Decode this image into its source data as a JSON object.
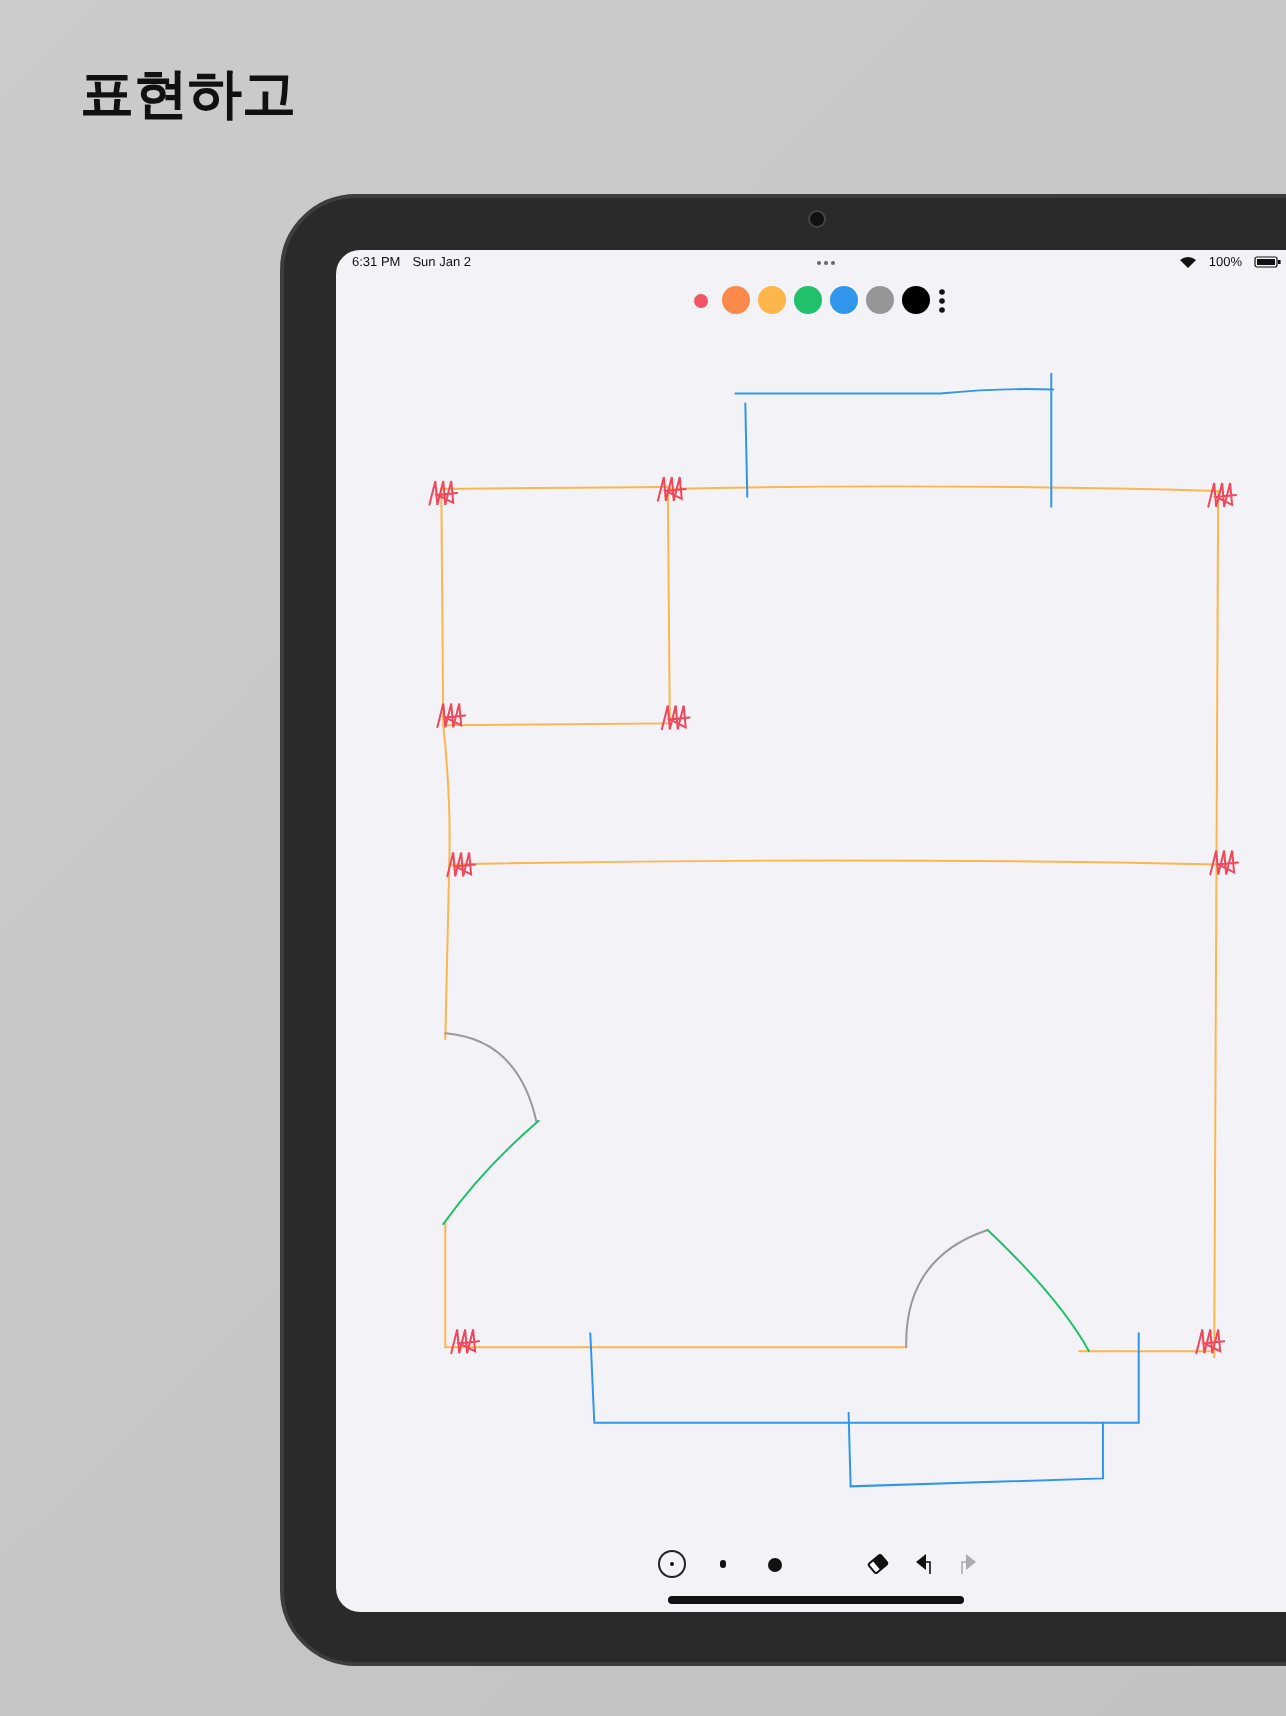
{
  "headline": "표현하고",
  "status_bar": {
    "time": "6:31 PM",
    "date": "Sun Jan 2",
    "battery": "100%"
  },
  "palette": [
    {
      "color": "#f25565",
      "selected": true
    },
    {
      "color": "#f98a4b",
      "selected": false
    },
    {
      "color": "#feb64a",
      "selected": false
    },
    {
      "color": "#21c16b",
      "selected": false
    },
    {
      "color": "#2f96ec",
      "selected": false
    },
    {
      "color": "#969696",
      "selected": false
    },
    {
      "color": "#000000",
      "selected": false
    }
  ],
  "pen_sizes": [
    {
      "kind": "fine",
      "selected": true
    },
    {
      "kind": "medium",
      "selected": false
    },
    {
      "kind": "bold",
      "selected": false
    }
  ],
  "tools": [
    {
      "kind": "eraser",
      "disabled": false
    },
    {
      "kind": "undo",
      "disabled": false
    },
    {
      "kind": "redo",
      "disabled": true
    }
  ]
}
